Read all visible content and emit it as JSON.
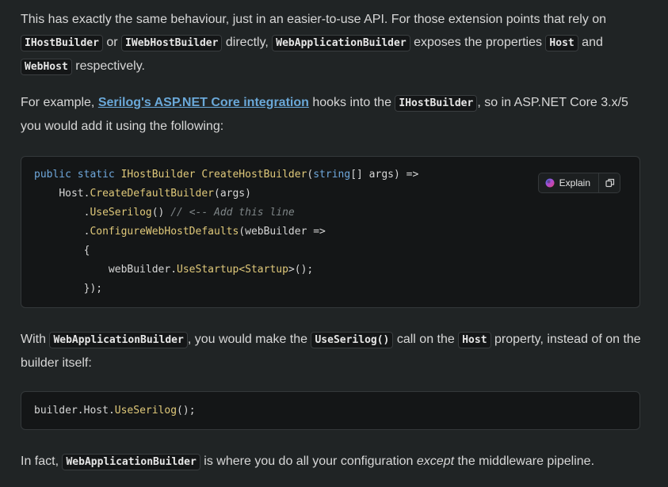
{
  "paragraph1": {
    "t1": "This has exactly the same behaviour, just in an easier-to-use API. For those extension points that rely on ",
    "c1": "IHostBuilder",
    "t2": " or ",
    "c2": "IWebHostBuilder",
    "t3": " directly, ",
    "c3": "WebApplicationBuilder",
    "t4": " exposes the properties ",
    "c4": "Host",
    "t5": " and ",
    "c5": "WebHost",
    "t6": " respectively."
  },
  "paragraph2": {
    "t1": "For example, ",
    "link": "Serilog's ASP.NET Core integration",
    "t2": " hooks into the ",
    "c1": "IHostBuilder",
    "t3": ", so in ASP.NET Core 3.x/5 you would add it using the following:"
  },
  "code1": {
    "l1": {
      "kw1": "public",
      "kw2": "static",
      "type": "IHostBuilder",
      "fn": "CreateHostBuilder",
      "p1": "(",
      "kw3": "string",
      "p2": "[] args) =>"
    },
    "l2": {
      "obj": "Host",
      "dot": ".",
      "fn": "CreateDefaultBuilder",
      "rest": "(args)"
    },
    "l3": {
      "dot": ".",
      "fn": "UseSerilog",
      "rest": "() ",
      "comment": "// <-- Add this line"
    },
    "l4": {
      "dot": ".",
      "fn": "ConfigureWebHostDefaults",
      "rest": "(webBuilder =>"
    },
    "l5": "{",
    "l6": {
      "obj": "webBuilder",
      "dot": ".",
      "fn": "UseStartup",
      "lt": "<",
      "type": "Startup",
      "rest": ">();"
    },
    "l7": "});"
  },
  "explain_button": {
    "label": "Explain"
  },
  "paragraph3": {
    "t1": "With ",
    "c1": "WebApplicationBuilder",
    "t2": ", you would make the ",
    "c2": "UseSerilog()",
    "t3": " call on the ",
    "c3": "Host",
    "t4": " property, instead of on the builder itself:"
  },
  "code2": {
    "obj": "builder",
    "dot1": ".",
    "prop": "Host",
    "dot2": ".",
    "fn": "UseSerilog",
    "rest": "();"
  },
  "paragraph4": {
    "t1": "In fact, ",
    "c1": "WebApplicationBuilder",
    "t2": " is where you do all your configuration ",
    "em": "except",
    "t3": " the middleware pipeline."
  }
}
